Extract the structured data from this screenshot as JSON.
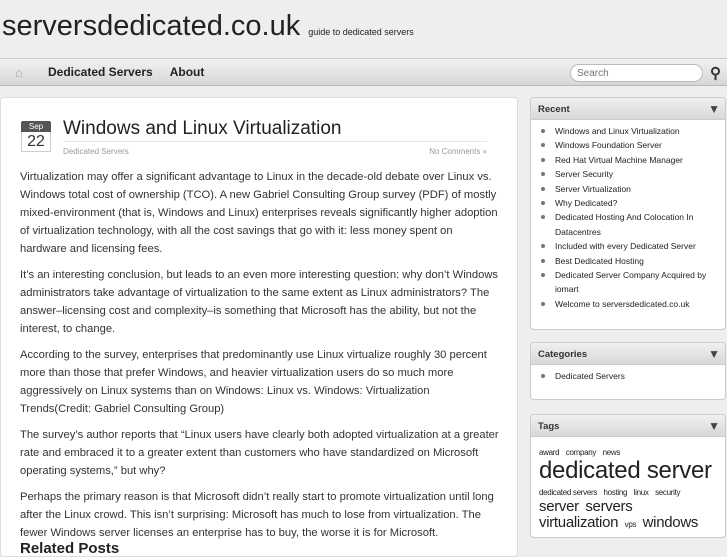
{
  "site": {
    "title": "serversdedicated.co.uk",
    "description": "guide to dedicated servers"
  },
  "nav": {
    "items": [
      "Dedicated Servers",
      "About"
    ],
    "search_placeholder": "Search"
  },
  "post": {
    "month": "Sep",
    "day": "22",
    "title": "Windows and Linux Virtualization",
    "category": "Dedicated Servers",
    "comments": "No Comments »",
    "paragraphs": [
      "Virtualization may offer a significant advantage to Linux in the decade-old debate over Linux vs. Windows total cost of ownership (TCO). A new Gabriel Consulting Group survey (PDF) of mostly mixed-environment (that is, Windows and Linux) enterprises reveals significantly higher adoption of virtualization technology, with all the cost savings that go with it: less money spent on hardware and licensing fees.",
      "It’s an interesting conclusion, but leads to an even more interesting question: why don’t Windows administrators take advantage of virtualization to the same extent as Linux administrators? The answer–licensing cost and complexity–is something that Microsoft has the ability, but not the interest, to change.",
      "According to the survey, enterprises that predominantly use Linux virtualize roughly 30 percent more than those that prefer Windows, and heavier virtualization users do so much more aggressively on Linux systems than on Windows: Linux vs. Windows: Virtualization Trends(Credit: Gabriel Consulting Group)",
      "The survey’s author reports that “Linux users have clearly both adopted virtualization at a greater rate and embraced it to a greater extent than customers who have standardized on Microsoft operating systems,” but why?",
      "Perhaps the primary reason is that Microsoft didn’t really start to promote virtualization until long after the Linux crowd. This isn’t surprising: Microsoft has much to lose from virtualization. The fewer Windows server licenses an enterprise has to buy, the worse it is for Microsoft."
    ],
    "related_heading": "Related Posts"
  },
  "sidebar": {
    "recent": {
      "title": "Recent",
      "items": [
        "Windows and Linux Virtualization",
        "Windows Foundation Server",
        "Red Hat Virtual Machine Manager",
        "Server Security",
        "Server Virtualization",
        "Why Dedicated?",
        "Dedicated Hosting And Colocation In Datacentres",
        "Included with every Dedicated Server",
        "Best Dedicated Hosting",
        "Dedicated Server Company Acquired by iomart",
        "Welcome to serversdedicated.co.uk"
      ]
    },
    "categories": {
      "title": "Categories",
      "items": [
        "Dedicated Servers"
      ]
    },
    "tags": {
      "title": "Tags",
      "items": [
        {
          "label": "award",
          "size": 8
        },
        {
          "label": "company",
          "size": 8
        },
        {
          "label": "news",
          "size": 8
        },
        {
          "label": "dedicated",
          "size": 24
        },
        {
          "label": "server",
          "size": 24
        },
        {
          "label": "dedicated servers",
          "size": 8
        },
        {
          "label": "hosting",
          "size": 8
        },
        {
          "label": "linux",
          "size": 8
        },
        {
          "label": "security",
          "size": 8
        },
        {
          "label": "server",
          "size": 15
        },
        {
          "label": "servers",
          "size": 15
        },
        {
          "label": "virtualization",
          "size": 15
        },
        {
          "label": "vps",
          "size": 8
        },
        {
          "label": "windows",
          "size": 15
        }
      ]
    }
  }
}
